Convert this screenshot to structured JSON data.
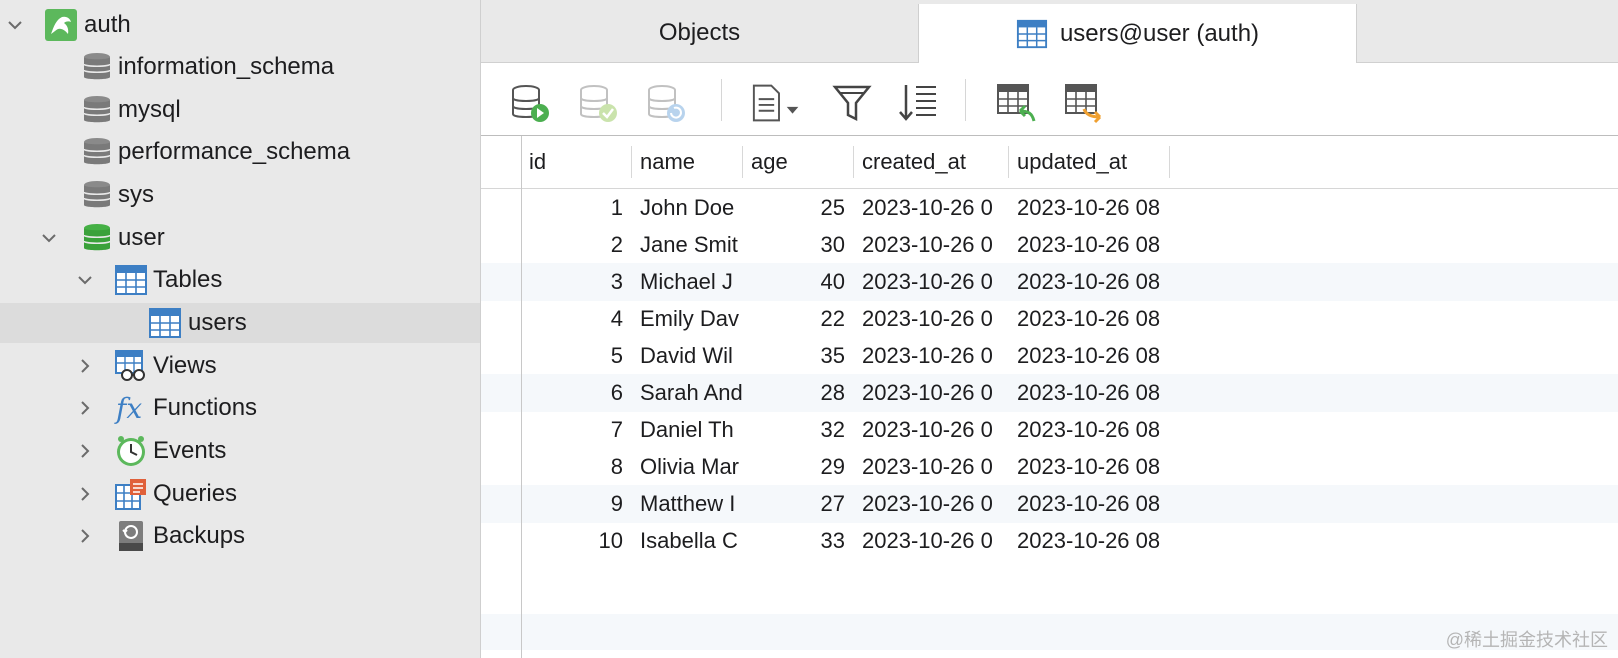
{
  "sidebar": {
    "items": [
      {
        "label": "auth",
        "icon": "mysql-connection-icon",
        "chevron": "down"
      },
      {
        "label": "information_schema",
        "icon": "database-icon"
      },
      {
        "label": "mysql",
        "icon": "database-icon"
      },
      {
        "label": "performance_schema",
        "icon": "database-icon"
      },
      {
        "label": "sys",
        "icon": "database-icon"
      },
      {
        "label": "user",
        "icon": "database-open-icon",
        "chevron": "down"
      },
      {
        "label": "Tables",
        "icon": "tables-icon",
        "chevron": "down"
      },
      {
        "label": "users",
        "icon": "table-icon",
        "selected": true
      },
      {
        "label": "Views",
        "icon": "views-icon",
        "chevron": "right"
      },
      {
        "label": "Functions",
        "icon": "function-icon",
        "chevron": "right"
      },
      {
        "label": "Events",
        "icon": "events-clock-icon",
        "chevron": "right"
      },
      {
        "label": "Queries",
        "icon": "queries-icon",
        "chevron": "right"
      },
      {
        "label": "Backups",
        "icon": "backups-icon",
        "chevron": "right"
      }
    ]
  },
  "tabs": {
    "objects": "Objects",
    "active": "users@user (auth)"
  },
  "toolbar": {
    "buttons": [
      "add-record-icon",
      "save-record-icon",
      "refresh-record-icon",
      "text-view-icon",
      "filter-icon",
      "sort-icon",
      "import-icon",
      "export-icon"
    ]
  },
  "grid": {
    "columns": [
      "id",
      "name",
      "age",
      "created_at",
      "updated_at"
    ],
    "rows": [
      [
        "1",
        "John Doe",
        "25",
        "2023-10-26 0",
        "2023-10-26 08"
      ],
      [
        "2",
        "Jane Smit",
        "30",
        "2023-10-26 0",
        "2023-10-26 08"
      ],
      [
        "3",
        "Michael J",
        "40",
        "2023-10-26 0",
        "2023-10-26 08"
      ],
      [
        "4",
        "Emily Dav",
        "22",
        "2023-10-26 0",
        "2023-10-26 08"
      ],
      [
        "5",
        "David Wil",
        "35",
        "2023-10-26 0",
        "2023-10-26 08"
      ],
      [
        "6",
        "Sarah And",
        "28",
        "2023-10-26 0",
        "2023-10-26 08"
      ],
      [
        "7",
        "Daniel Th",
        "32",
        "2023-10-26 0",
        "2023-10-26 08"
      ],
      [
        "8",
        "Olivia Mar",
        "29",
        "2023-10-26 0",
        "2023-10-26 08"
      ],
      [
        "9",
        "Matthew I",
        "27",
        "2023-10-26 0",
        "2023-10-26 08"
      ],
      [
        "10",
        "Isabella C",
        "33",
        "2023-10-26 0",
        "2023-10-26 08"
      ]
    ]
  },
  "watermark": "@稀土掘金技术社区",
  "colors": {
    "sidebar_bg": "#e9e9e9",
    "selected_row": "#dcdcdc",
    "db_gray": "#8a8a8a",
    "db_green": "#3aa13a",
    "table_blue": "#3d7fc4",
    "alt_row": "#f5f8fb"
  }
}
